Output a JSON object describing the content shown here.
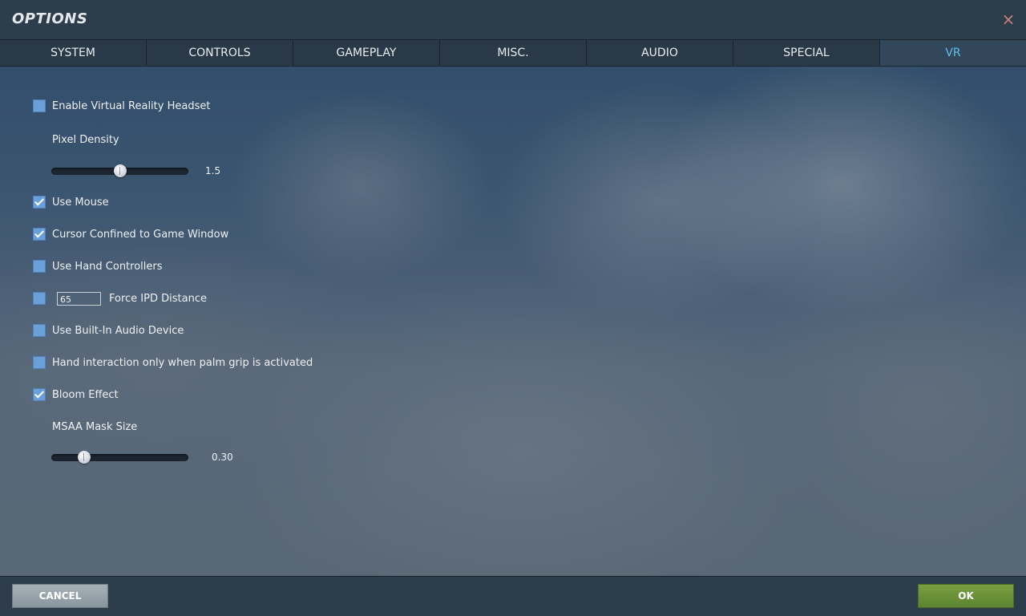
{
  "window": {
    "title": "OPTIONS",
    "close_icon": "×"
  },
  "tabs": [
    {
      "label": "SYSTEM",
      "active": false
    },
    {
      "label": "CONTROLS",
      "active": false
    },
    {
      "label": "GAMEPLAY",
      "active": false
    },
    {
      "label": "MISC.",
      "active": false
    },
    {
      "label": "AUDIO",
      "active": false
    },
    {
      "label": "SPECIAL",
      "active": false
    },
    {
      "label": "VR",
      "active": true
    }
  ],
  "vr": {
    "enable_headset": {
      "label": "Enable Virtual Reality Headset",
      "checked": false
    },
    "pixel_density": {
      "label": "Pixel Density",
      "value": "1.5",
      "fraction": 0.5
    },
    "use_mouse": {
      "label": "Use Mouse",
      "checked": true
    },
    "cursor_confined": {
      "label": "Cursor Confined to Game Window",
      "checked": true
    },
    "hand_controllers": {
      "label": "Use Hand Controllers",
      "checked": false
    },
    "force_ipd": {
      "label": "Force IPD Distance",
      "checked": false,
      "value": "65"
    },
    "builtin_audio": {
      "label": "Use Built-In Audio Device",
      "checked": false
    },
    "palm_grip": {
      "label": "Hand interaction only when palm grip is activated",
      "checked": false
    },
    "bloom": {
      "label": "Bloom Effect",
      "checked": true
    },
    "msaa_mask": {
      "label": "MSAA Mask Size",
      "value": "0.30",
      "fraction": 0.24
    }
  },
  "footer": {
    "cancel_label": "CANCEL",
    "ok_label": "OK"
  },
  "colors": {
    "active_tab": "#5cc0e8",
    "checkbox": "#6a9fd8",
    "ok_button": "#6a9139",
    "cancel_button": "#97a3aa",
    "close_icon": "#c8837a"
  }
}
